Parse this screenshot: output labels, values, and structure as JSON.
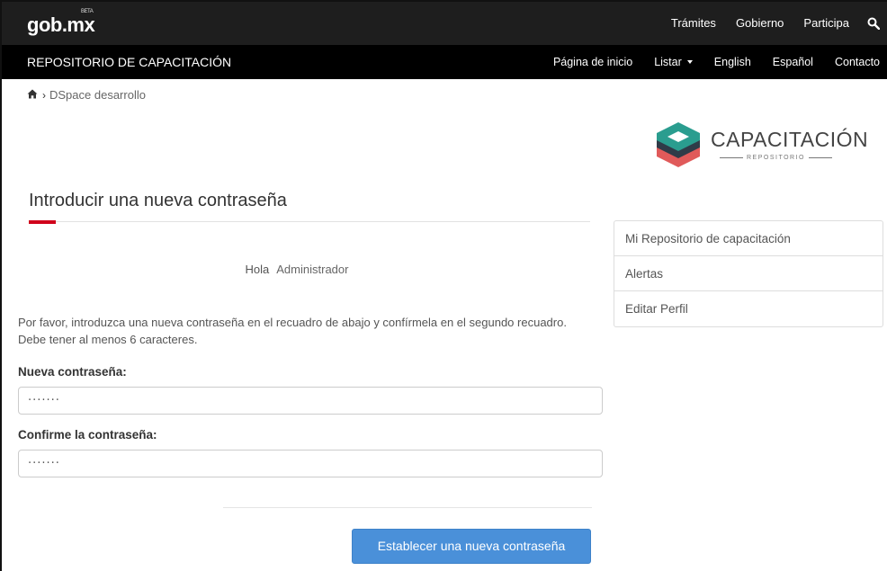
{
  "gov_header": {
    "logo_text": "gob.mx",
    "logo_badge": "BETA",
    "nav": [
      "Trámites",
      "Gobierno",
      "Participa"
    ],
    "search_icon": "search-icon"
  },
  "repo_header": {
    "title": "REPOSITORIO DE CAPACITACIÓN",
    "nav": {
      "home": "Página de inicio",
      "browse": "Listar",
      "english": "English",
      "spanish": "Español",
      "contact": "Contacto"
    }
  },
  "breadcrumb": {
    "home_icon": "home-icon",
    "current": "DSpace desarrollo"
  },
  "logo": {
    "word": "CAPACITACIÓN",
    "sub": "REPOSITORIO"
  },
  "main": {
    "heading": "Introducir una nueva contraseña",
    "greeting": "Hola",
    "user_name": "Administrador",
    "instruction": "Por favor, introduzca una nueva contraseña en el recuadro de abajo y confírmela en el segundo recuadro. Debe tener al menos 6 caracteres.",
    "new_password_label": "Nueva contraseña:",
    "new_password_value": "·······",
    "confirm_password_label": "Confirme la contraseña:",
    "confirm_password_value": "·······",
    "submit_label": "Establecer una nueva contraseña"
  },
  "sidebar": {
    "items": [
      "Mi Repositorio de capacitación",
      "Alertas",
      "Editar Perfil"
    ]
  },
  "colors": {
    "gov_bar": "#1e1e1e",
    "repo_bar": "#000000",
    "accent_red": "#d0021b",
    "button_blue": "#4a90d9",
    "logo_teal": "#2a9d8f",
    "logo_red": "#e05a5a",
    "logo_dark": "#2f3b48"
  }
}
